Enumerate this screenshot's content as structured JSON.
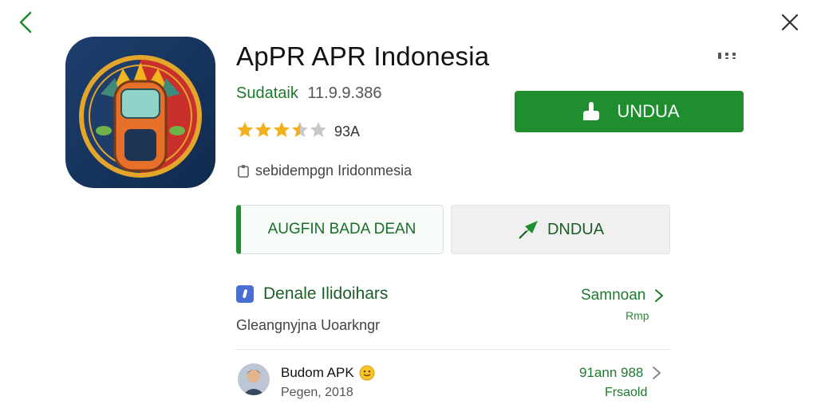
{
  "app": {
    "title": "ApPR APR Indonesia",
    "developer": "Sudataik",
    "version": "11.9.9.386",
    "rating_count": "93A",
    "rating": 3.5,
    "info": "sebidempgn Iridonmesia"
  },
  "actions": {
    "install_label": "UNDUA",
    "secondary_left_label": "AUGFIN BADA DEAN",
    "secondary_right_label": "DNDUA"
  },
  "section": {
    "title": "Denale Ilidoihars",
    "subtitle": "Gleangnyjna Uoarkngr",
    "see_all_label": "Samnoan",
    "see_all_sub": "Rmp"
  },
  "review": {
    "name": "Budom APK",
    "date": "Pegen, 2018",
    "stat": "91ann 988",
    "stat_sub": "Frsaold"
  },
  "colors": {
    "accent": "#1f8e2e",
    "star": "#f2b01e",
    "star_empty": "#c8c8c8",
    "text_green": "#1b7a2e"
  },
  "icons": [
    "back-arrow-icon",
    "close-icon",
    "more-dots-icon",
    "hand-icon",
    "star-icon",
    "info-icon",
    "leaf-arrow-icon",
    "blue-square-icon",
    "chevron-right-icon",
    "smiley-emoji-icon"
  ]
}
